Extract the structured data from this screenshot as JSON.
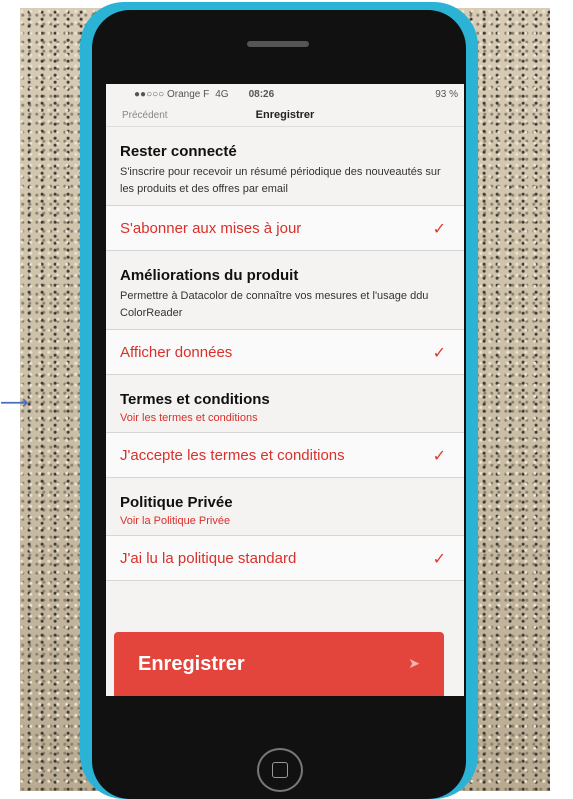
{
  "status": {
    "carrier": "●●○○○ Orange F",
    "network": "4G",
    "time": "08:26",
    "battery": "93 %"
  },
  "nav": {
    "back_label": "Précédent",
    "title": "Enregistrer"
  },
  "sections": [
    {
      "title": "Rester connecté",
      "description": "S'inscrire pour recevoir un résumé périodique des nouveautés sur les produits et des offres par email",
      "row_label": "S'abonner aux mises à jour"
    },
    {
      "title": "Améliorations du produit",
      "description": "Permettre à Datacolor de connaître vos mesures et l'usage ddu ColorReader",
      "row_label": "Afficher données"
    },
    {
      "title": "Termes et conditions",
      "link": "Voir les termes et conditions",
      "row_label": "J'accepte les termes et conditions"
    },
    {
      "title": "Politique Privée",
      "link": "Voir la Politique Privée",
      "row_label": "J'ai lu la politique standard"
    }
  ],
  "check_glyph": "✓",
  "submit_label": "Enregistrer",
  "colors": {
    "accent": "#d9302b",
    "button": "#e3443c",
    "phone_case": "#2bb3d6"
  }
}
